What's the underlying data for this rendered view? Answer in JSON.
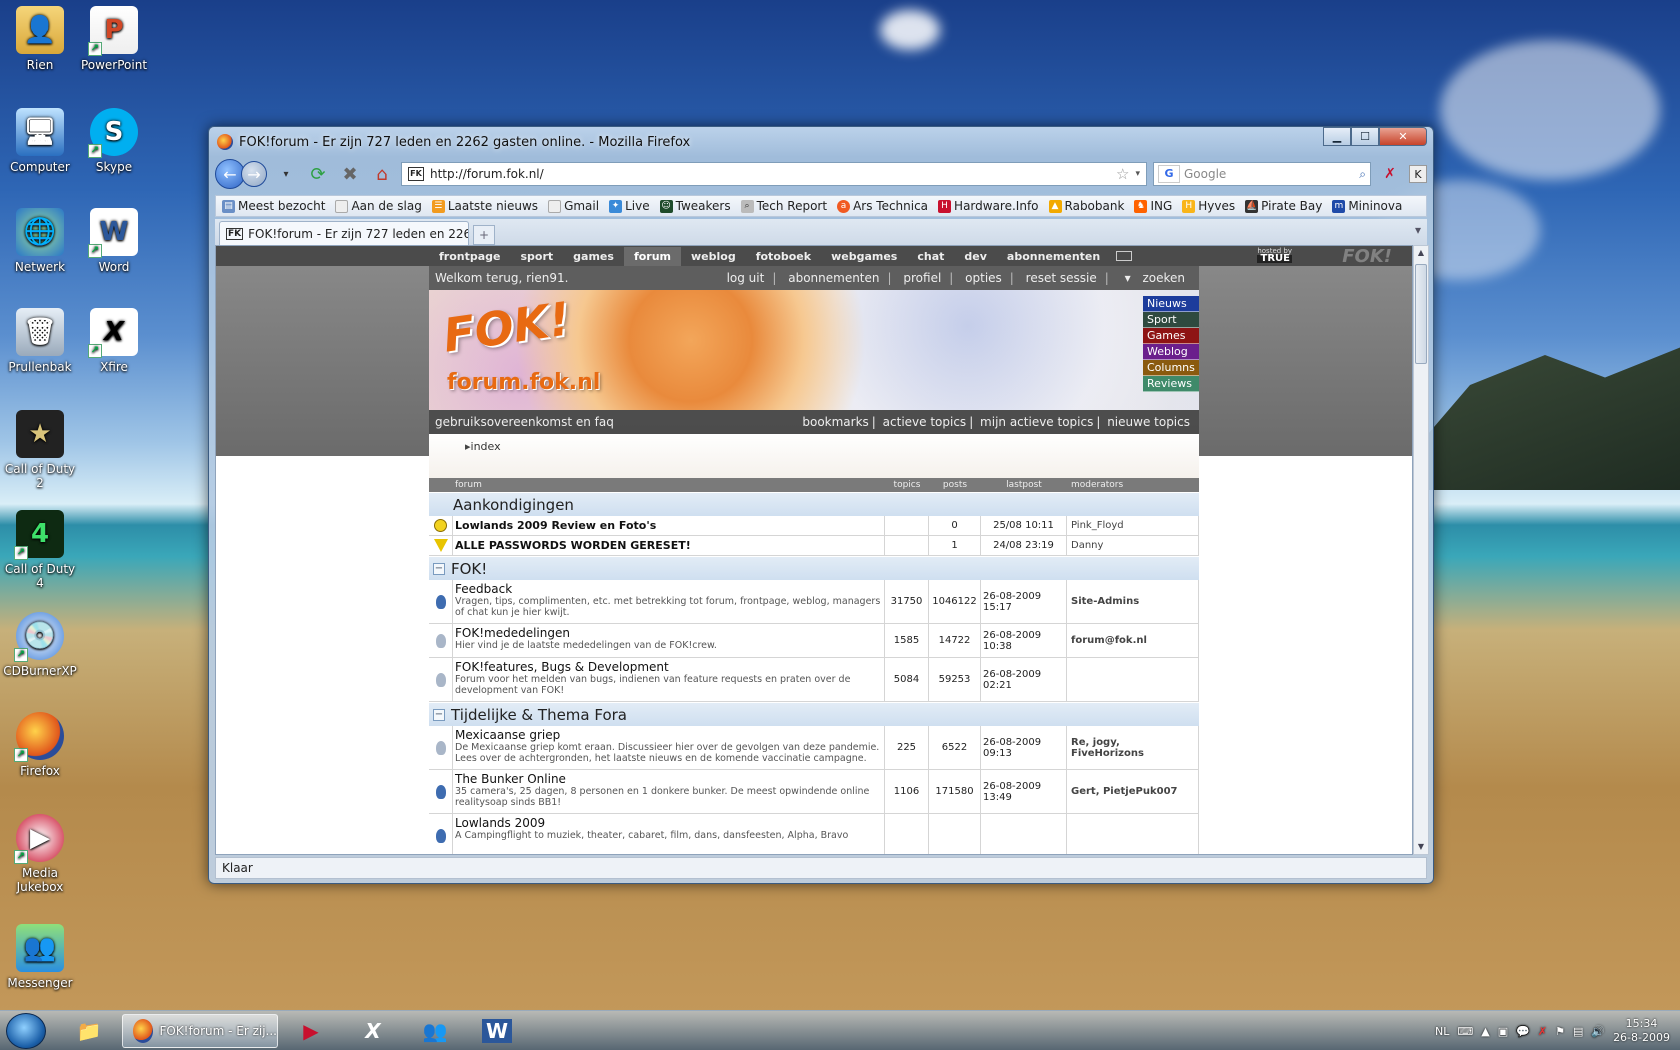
{
  "desktop": {
    "icons": [
      "Rien",
      "PowerPoint",
      "Computer",
      "Skype",
      "Netwerk",
      "Word",
      "Prullenbak",
      "Xfire",
      "Call of Duty 2",
      "Call of Duty 4",
      "CDBurnerXP",
      "Firefox",
      "Media Jukebox",
      "Messenger"
    ]
  },
  "window": {
    "title": "FOK!forum - Er zijn 727 leden en 2262 gasten online. - Mozilla Firefox",
    "url": "http://forum.fok.nl/",
    "search_placeholder": "Google",
    "bookmarks": [
      "Meest bezocht",
      "Aan de slag",
      "Laatste nieuws",
      "Gmail",
      "Live",
      "Tweakers",
      "Tech Report",
      "Ars Technica",
      "Hardware.Info",
      "Rabobank",
      "ING",
      "Hyves",
      "Pirate Bay",
      "Mininova"
    ],
    "tab_label": "FOK!forum - Er zijn 727 leden en 226...",
    "status": "Klaar"
  },
  "page": {
    "topnav": [
      "frontpage",
      "sport",
      "games",
      "forum",
      "weblog",
      "fotoboek",
      "webgames",
      "chat",
      "dev",
      "abonnementen"
    ],
    "hosted_by": "hosted by",
    "hosted_brand": "TRUE",
    "fok_mark": "FOK!",
    "welcome": "Welkom terug, rien91.",
    "user_links": [
      "log uit",
      "abonnementen",
      "profiel",
      "opties",
      "reset sessie",
      "zoeken"
    ],
    "logo": "FOK!",
    "logo_sub": "forum.fok.nl",
    "categories": [
      {
        "label": "Nieuws",
        "color": "#1c3c9c"
      },
      {
        "label": "Sport",
        "color": "#2f4a3f"
      },
      {
        "label": "Games",
        "color": "#8e1414"
      },
      {
        "label": "Weblog",
        "color": "#6b1f8c"
      },
      {
        "label": "Columns",
        "color": "#8a5a0e"
      },
      {
        "label": "Reviews",
        "color": "#3f8a6a"
      }
    ],
    "faq": "gebruiksovereenkomst en faq",
    "sub_links": [
      "bookmarks",
      "actieve topics",
      "mijn actieve topics",
      "nieuwe topics"
    ],
    "crumb": "index",
    "headers": {
      "forum": "forum",
      "topics": "topics",
      "posts": "posts",
      "lastpost": "lastpost",
      "moderators": "moderators"
    },
    "sections": {
      "announcements": "Aankondigingen",
      "fok": "FOK!",
      "thema": "Tijdelijke & Thema Fora"
    },
    "announcements": [
      {
        "title": "Lowlands 2009 Review en Foto's",
        "posts": "0",
        "last": "25/08 10:11",
        "mod": "Pink_Floyd"
      },
      {
        "title": "ALLE PASSWORDS WORDEN GERESET!",
        "posts": "1",
        "last": "24/08 23:19",
        "mod": "Danny"
      }
    ],
    "fok_forums": [
      {
        "title": "Feedback",
        "desc": "Vragen, tips, complimenten, etc. met betrekking tot forum, frontpage, weblog, managers of chat kun je hier kwijt.",
        "topics": "31750",
        "posts": "1046122",
        "last": "26-08-2009 15:17",
        "mod": "Site-Admins"
      },
      {
        "title": "FOK!mededelingen",
        "desc": "Hier vind je de laatste mededelingen van de FOK!crew.",
        "topics": "1585",
        "posts": "14722",
        "last": "26-08-2009 10:38",
        "mod": "forum@fok.nl"
      },
      {
        "title": "FOK!features, Bugs & Development",
        "desc": "Forum voor het melden van bugs, indienen van feature requests en praten over de development van FOK!",
        "topics": "5084",
        "posts": "59253",
        "last": "26-08-2009 02:21",
        "mod": ""
      }
    ],
    "thema_forums": [
      {
        "title": "Mexicaanse griep",
        "desc": "De Mexicaanse griep komt eraan. Discussieer hier over de gevolgen van deze pandemie. Lees over de achtergronden, het laatste nieuws en de komende vaccinatie campagne.",
        "topics": "225",
        "posts": "6522",
        "last": "26-08-2009 09:13",
        "mod": "Re, jogy, FiveHorizons"
      },
      {
        "title": "The Bunker Online",
        "desc": "35 camera's, 25 dagen, 8 personen en 1 donkere bunker. De meest opwindende online realitysoap sinds BB1!",
        "topics": "1106",
        "posts": "171580",
        "last": "26-08-2009 13:49",
        "mod": "Gert, PietjePuk007"
      },
      {
        "title": "Lowlands 2009",
        "desc": "A Campingflight to muziek, theater, cabaret, film, dans, dansfeesten, Alpha, Bravo",
        "topics": "",
        "posts": "",
        "last": "",
        "mod": ""
      }
    ]
  },
  "taskbar": {
    "active_label": "FOK!forum - Er zij...",
    "lang": "NL",
    "time": "15:34",
    "date": "26-8-2009"
  }
}
